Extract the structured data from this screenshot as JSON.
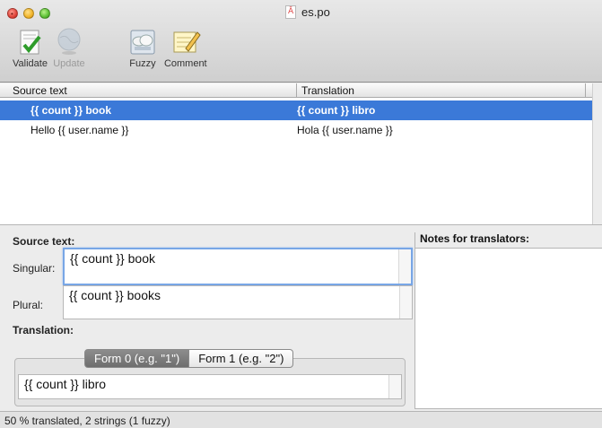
{
  "window": {
    "title": "es.po",
    "file_icon": "po-file-icon"
  },
  "toolbar": {
    "validate_label": "Validate",
    "update_label": "Update",
    "fuzzy_label": "Fuzzy",
    "comment_label": "Comment"
  },
  "table": {
    "columns": [
      "Source text",
      "Translation"
    ],
    "rows": [
      {
        "source": "{{ count }} book",
        "translation": "{{ count }} libro",
        "selected": true
      },
      {
        "source": "Hello {{ user.name }}",
        "translation": "Hola {{ user.name }}",
        "selected": false
      }
    ]
  },
  "editor": {
    "source_text_label": "Source text:",
    "singular_label": "Singular:",
    "singular_value": "{{ count }} book",
    "plural_label": "Plural:",
    "plural_value": "{{ count }} books",
    "translation_label": "Translation:",
    "form_tabs": [
      "Form 0 (e.g. \"1\")",
      "Form 1 (e.g. \"2\")"
    ],
    "translation_value": "{{ count }} libro"
  },
  "notes": {
    "header": "Notes for translators:"
  },
  "status": {
    "text": "50 % translated, 2 strings (1 fuzzy)"
  },
  "colors": {
    "selection": "#3b79d8",
    "focus_ring": "#78a6e6"
  }
}
